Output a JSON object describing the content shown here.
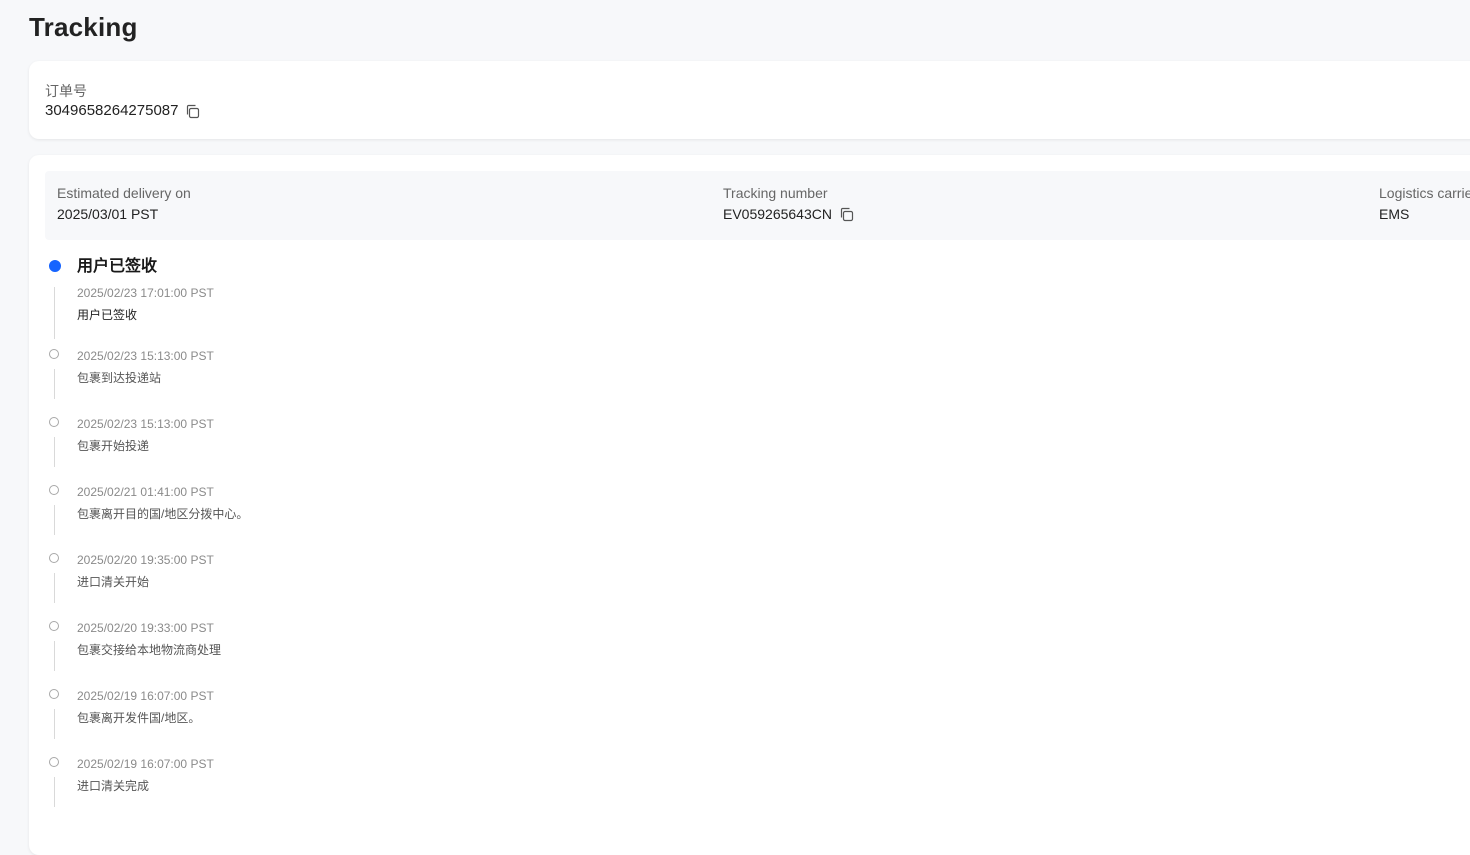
{
  "page": {
    "title": "Tracking"
  },
  "order": {
    "label": "订单号",
    "number": "3049658264275087"
  },
  "summary": {
    "estimated_label": "Estimated delivery on",
    "estimated_value": "2025/03/01 PST",
    "tracking_label": "Tracking number",
    "tracking_value": "EV059265643CN",
    "carrier_label": "Logistics carrie",
    "carrier_value": "EMS"
  },
  "timeline": {
    "current_status": "用户已签收",
    "events": [
      {
        "time": "2025/02/23 17:01:00 PST",
        "desc": "用户已签收"
      },
      {
        "time": "2025/02/23 15:13:00 PST",
        "desc": "包裹到达投递站"
      },
      {
        "time": "2025/02/23 15:13:00 PST",
        "desc": "包裹开始投递"
      },
      {
        "time": "2025/02/21 01:41:00 PST",
        "desc": "包裹离开目的国/地区分拨中心。"
      },
      {
        "time": "2025/02/20 19:35:00 PST",
        "desc": "进口清关开始"
      },
      {
        "time": "2025/02/20 19:33:00 PST",
        "desc": "包裹交接给本地物流商处理"
      },
      {
        "time": "2025/02/19 16:07:00 PST",
        "desc": "包裹离开发件国/地区。"
      },
      {
        "time": "2025/02/19 16:07:00 PST",
        "desc": "进口清关完成"
      }
    ]
  },
  "colors": {
    "accent": "#1664ff",
    "background": "#f7f8fa",
    "card": "#ffffff"
  },
  "icons": {
    "copy": "copy-icon"
  }
}
